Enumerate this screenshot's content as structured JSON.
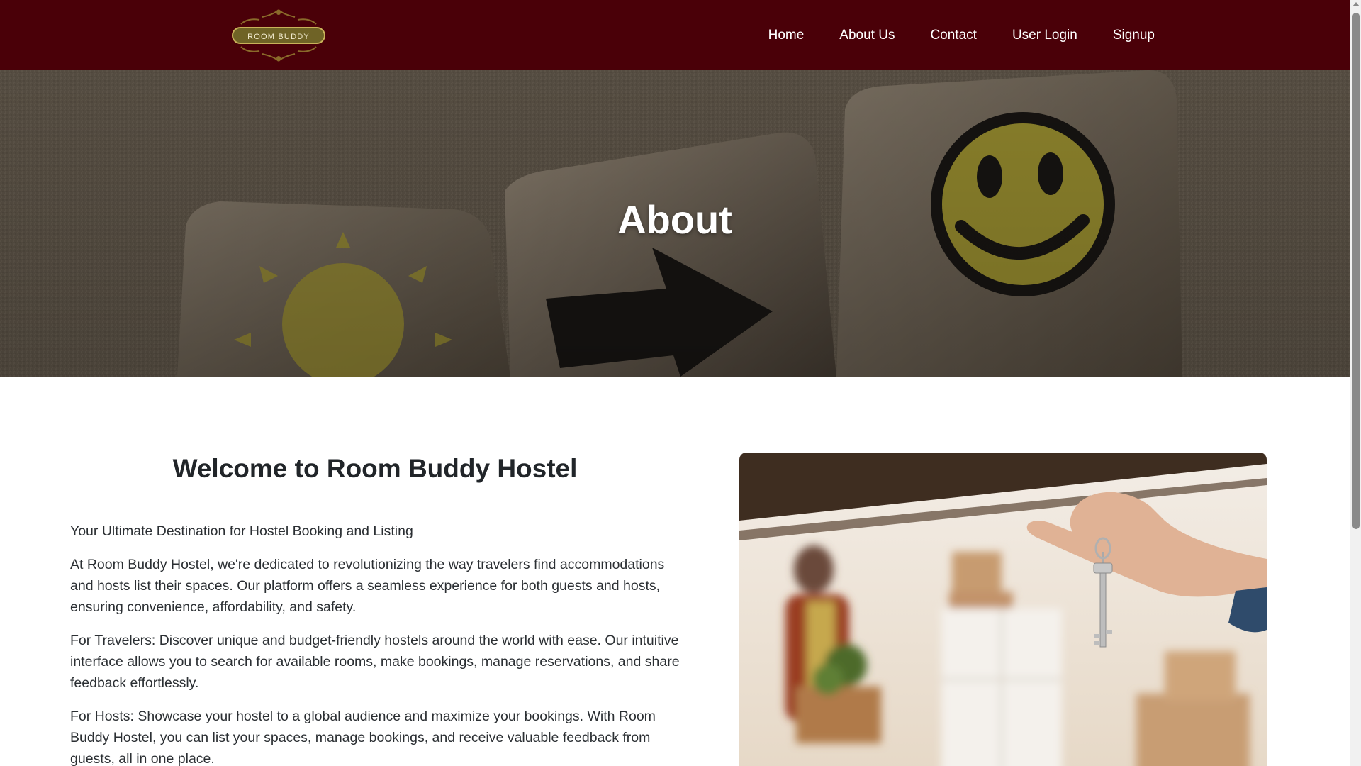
{
  "brand": {
    "logo_text": "ROOM BUDDY"
  },
  "nav": {
    "items": [
      {
        "label": "Home"
      },
      {
        "label": "About Us"
      },
      {
        "label": "Contact"
      },
      {
        "label": "User Login"
      },
      {
        "label": "Signup"
      }
    ]
  },
  "hero": {
    "title": "About"
  },
  "main": {
    "title": "Welcome to Room Buddy Hostel",
    "paragraphs": [
      "Your Ultimate Destination for Hostel Booking and Listing",
      "At Room Buddy Hostel, we're dedicated to revolutionizing the way travelers find accommodations and hosts list their spaces. Our platform offers a seamless experience for both guests and hosts, ensuring convenience, affordability, and safety.",
      "For Travelers: Discover unique and budget-friendly hostels around the world with ease. Our intuitive interface allows you to search for available rooms, make bookings, manage reservations, and share feedback effortlessly.",
      "For Hosts: Showcase your hostel to a global audience and maximize your bookings. With Room Buddy Hostel, you can list your spaces, manage bookings, and receive valuable feedback from guests, all in one place."
    ]
  },
  "colors": {
    "navbar": "#4a0008",
    "logo_gold": "#8a7a2e",
    "text": "#212529"
  }
}
